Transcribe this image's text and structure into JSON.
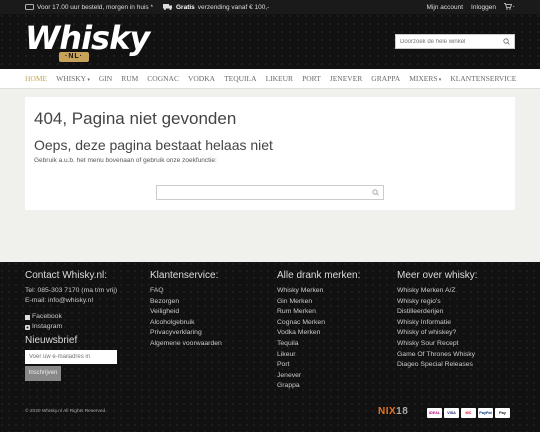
{
  "topbar": {
    "delivery_text": "Voor 17.00 uur besteld, morgen in huis *",
    "shipping_bold": "Gratis",
    "shipping_text": "verzending vanaf € 100,-",
    "account": "Mijn account",
    "login": "Inloggen"
  },
  "header": {
    "logo_text": "Whisky",
    "logo_sub": "·NL·",
    "search_placeholder": "Doorzoek de hele winkel"
  },
  "nav": {
    "items": [
      {
        "label": "HOME"
      },
      {
        "label": "WHISKY",
        "dropdown": true
      },
      {
        "label": "GIN"
      },
      {
        "label": "RUM"
      },
      {
        "label": "COGNAC"
      },
      {
        "label": "VODKA"
      },
      {
        "label": "TEQUILA"
      },
      {
        "label": "LIKEUR"
      },
      {
        "label": "PORT"
      },
      {
        "label": "JENEVER"
      },
      {
        "label": "GRAPPA"
      },
      {
        "label": "MIXERS",
        "dropdown": true
      },
      {
        "label": "KLANTENSERVICE"
      }
    ]
  },
  "main": {
    "title": "404, Pagina niet gevonden",
    "subtitle": "Oeps, deze pagina bestaat helaas niet",
    "hint": "Gebruik a.u.b. het menu bovenaan of gebruik onze zoekfunctie:"
  },
  "footer": {
    "contact": {
      "heading": "Contact Whisky.nl:",
      "phone": "Tel: 085-303 7170 (ma t/m vrij)",
      "email": "E-mail: info@whisky.nl",
      "facebook": "Facebook",
      "instagram": "Instagram",
      "newsletter_heading": "Nieuwsbrief",
      "newsletter_placeholder": "Voer uw e-mailadres in",
      "subscribe_label": "Inschrijven"
    },
    "service": {
      "heading": "Klantenservice:",
      "links": [
        "FAQ",
        "Bezorgen",
        "Veiligheid",
        "Alcoholgebruik",
        "Privacyverklaring",
        "Algemene voorwaarden"
      ]
    },
    "brands": {
      "heading": "Alle drank merken:",
      "links": [
        "Whisky Merken",
        "Gin Merken",
        "Rum Merken",
        "Cognac Merken",
        "Vodka Merken",
        "Tequila",
        "Likeur",
        "Port",
        "Jenever",
        "Grappa"
      ]
    },
    "more": {
      "heading": "Meer over whisky:",
      "links": [
        "Whisky Merken A/Z",
        "Whisky regio's",
        "Distilleerderijen",
        "Whisky Informatie",
        "Whisky of whiskey?",
        "Whisky Sour Recept",
        "Game Of Thrones Whisky",
        "Diageo Special Releases"
      ]
    },
    "copyright": "© 2020 Whisky.nl All Rights Reserved.",
    "nix_logo": "NIX",
    "nix_suffix": "18",
    "payments": [
      "iDEAL",
      "VISA",
      "MC",
      "PayPal",
      "Pay"
    ]
  },
  "colors": {
    "accent": "#c8a45a",
    "footer_bg": "#111111",
    "nix_orange": "#e8741e"
  }
}
